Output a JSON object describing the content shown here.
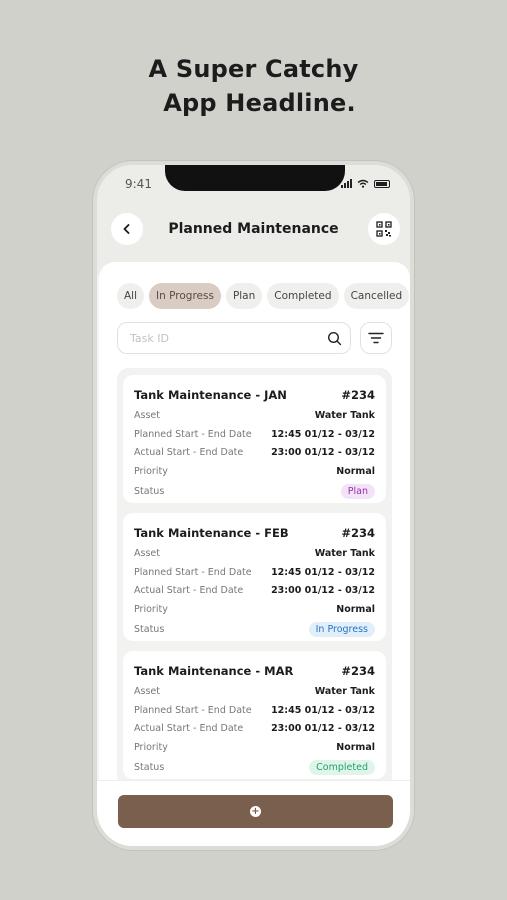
{
  "headline": {
    "line1": "A Super Catchy",
    "line2": "App Headline."
  },
  "status_bar": {
    "time": "9:41"
  },
  "header": {
    "title": "Planned Maintenance",
    "back_icon": "chevron-left-icon",
    "qr_icon": "qr-code-icon"
  },
  "filters": [
    {
      "label": "All",
      "active": false
    },
    {
      "label": "In Progress",
      "active": true
    },
    {
      "label": "Plan",
      "active": false
    },
    {
      "label": "Completed",
      "active": false
    },
    {
      "label": "Cancelled",
      "active": false
    }
  ],
  "search": {
    "placeholder": "Task ID"
  },
  "cards": [
    {
      "title": "Tank Maintenance - JAN",
      "id": "#234",
      "asset_label": "Asset",
      "asset": "Water Tank",
      "planned_label": "Planned Start - End Date",
      "planned": "12:45 01/12 - 03/12",
      "actual_label": "Actual Start - End Date",
      "actual": "23:00 01/12 - 03/12",
      "priority_label": "Priority",
      "priority": "Normal",
      "status_label": "Status",
      "status": "Plan"
    },
    {
      "title": "Tank Maintenance - FEB",
      "id": "#234",
      "asset_label": "Asset",
      "asset": "Water Tank",
      "planned_label": "Planned Start - End Date",
      "planned": "12:45 01/12 - 03/12",
      "actual_label": "Actual Start - End Date",
      "actual": "23:00 01/12 - 03/12",
      "priority_label": "Priority",
      "priority": "Normal",
      "status_label": "Status",
      "status": "In Progress"
    },
    {
      "title": "Tank Maintenance - MAR",
      "id": "#234",
      "asset_label": "Asset",
      "asset": "Water Tank",
      "planned_label": "Planned Start - End Date",
      "planned": "12:45 01/12 - 03/12",
      "actual_label": "Actual Start - End Date",
      "actual": "23:00 01/12 - 03/12",
      "priority_label": "Priority",
      "priority": "Normal",
      "status_label": "Status",
      "status": "Completed"
    }
  ],
  "footer": {
    "add_icon": "plus-circle-icon"
  },
  "colors": {
    "accent": "#7a5f4e",
    "chip_active": "#d9ccc4"
  }
}
